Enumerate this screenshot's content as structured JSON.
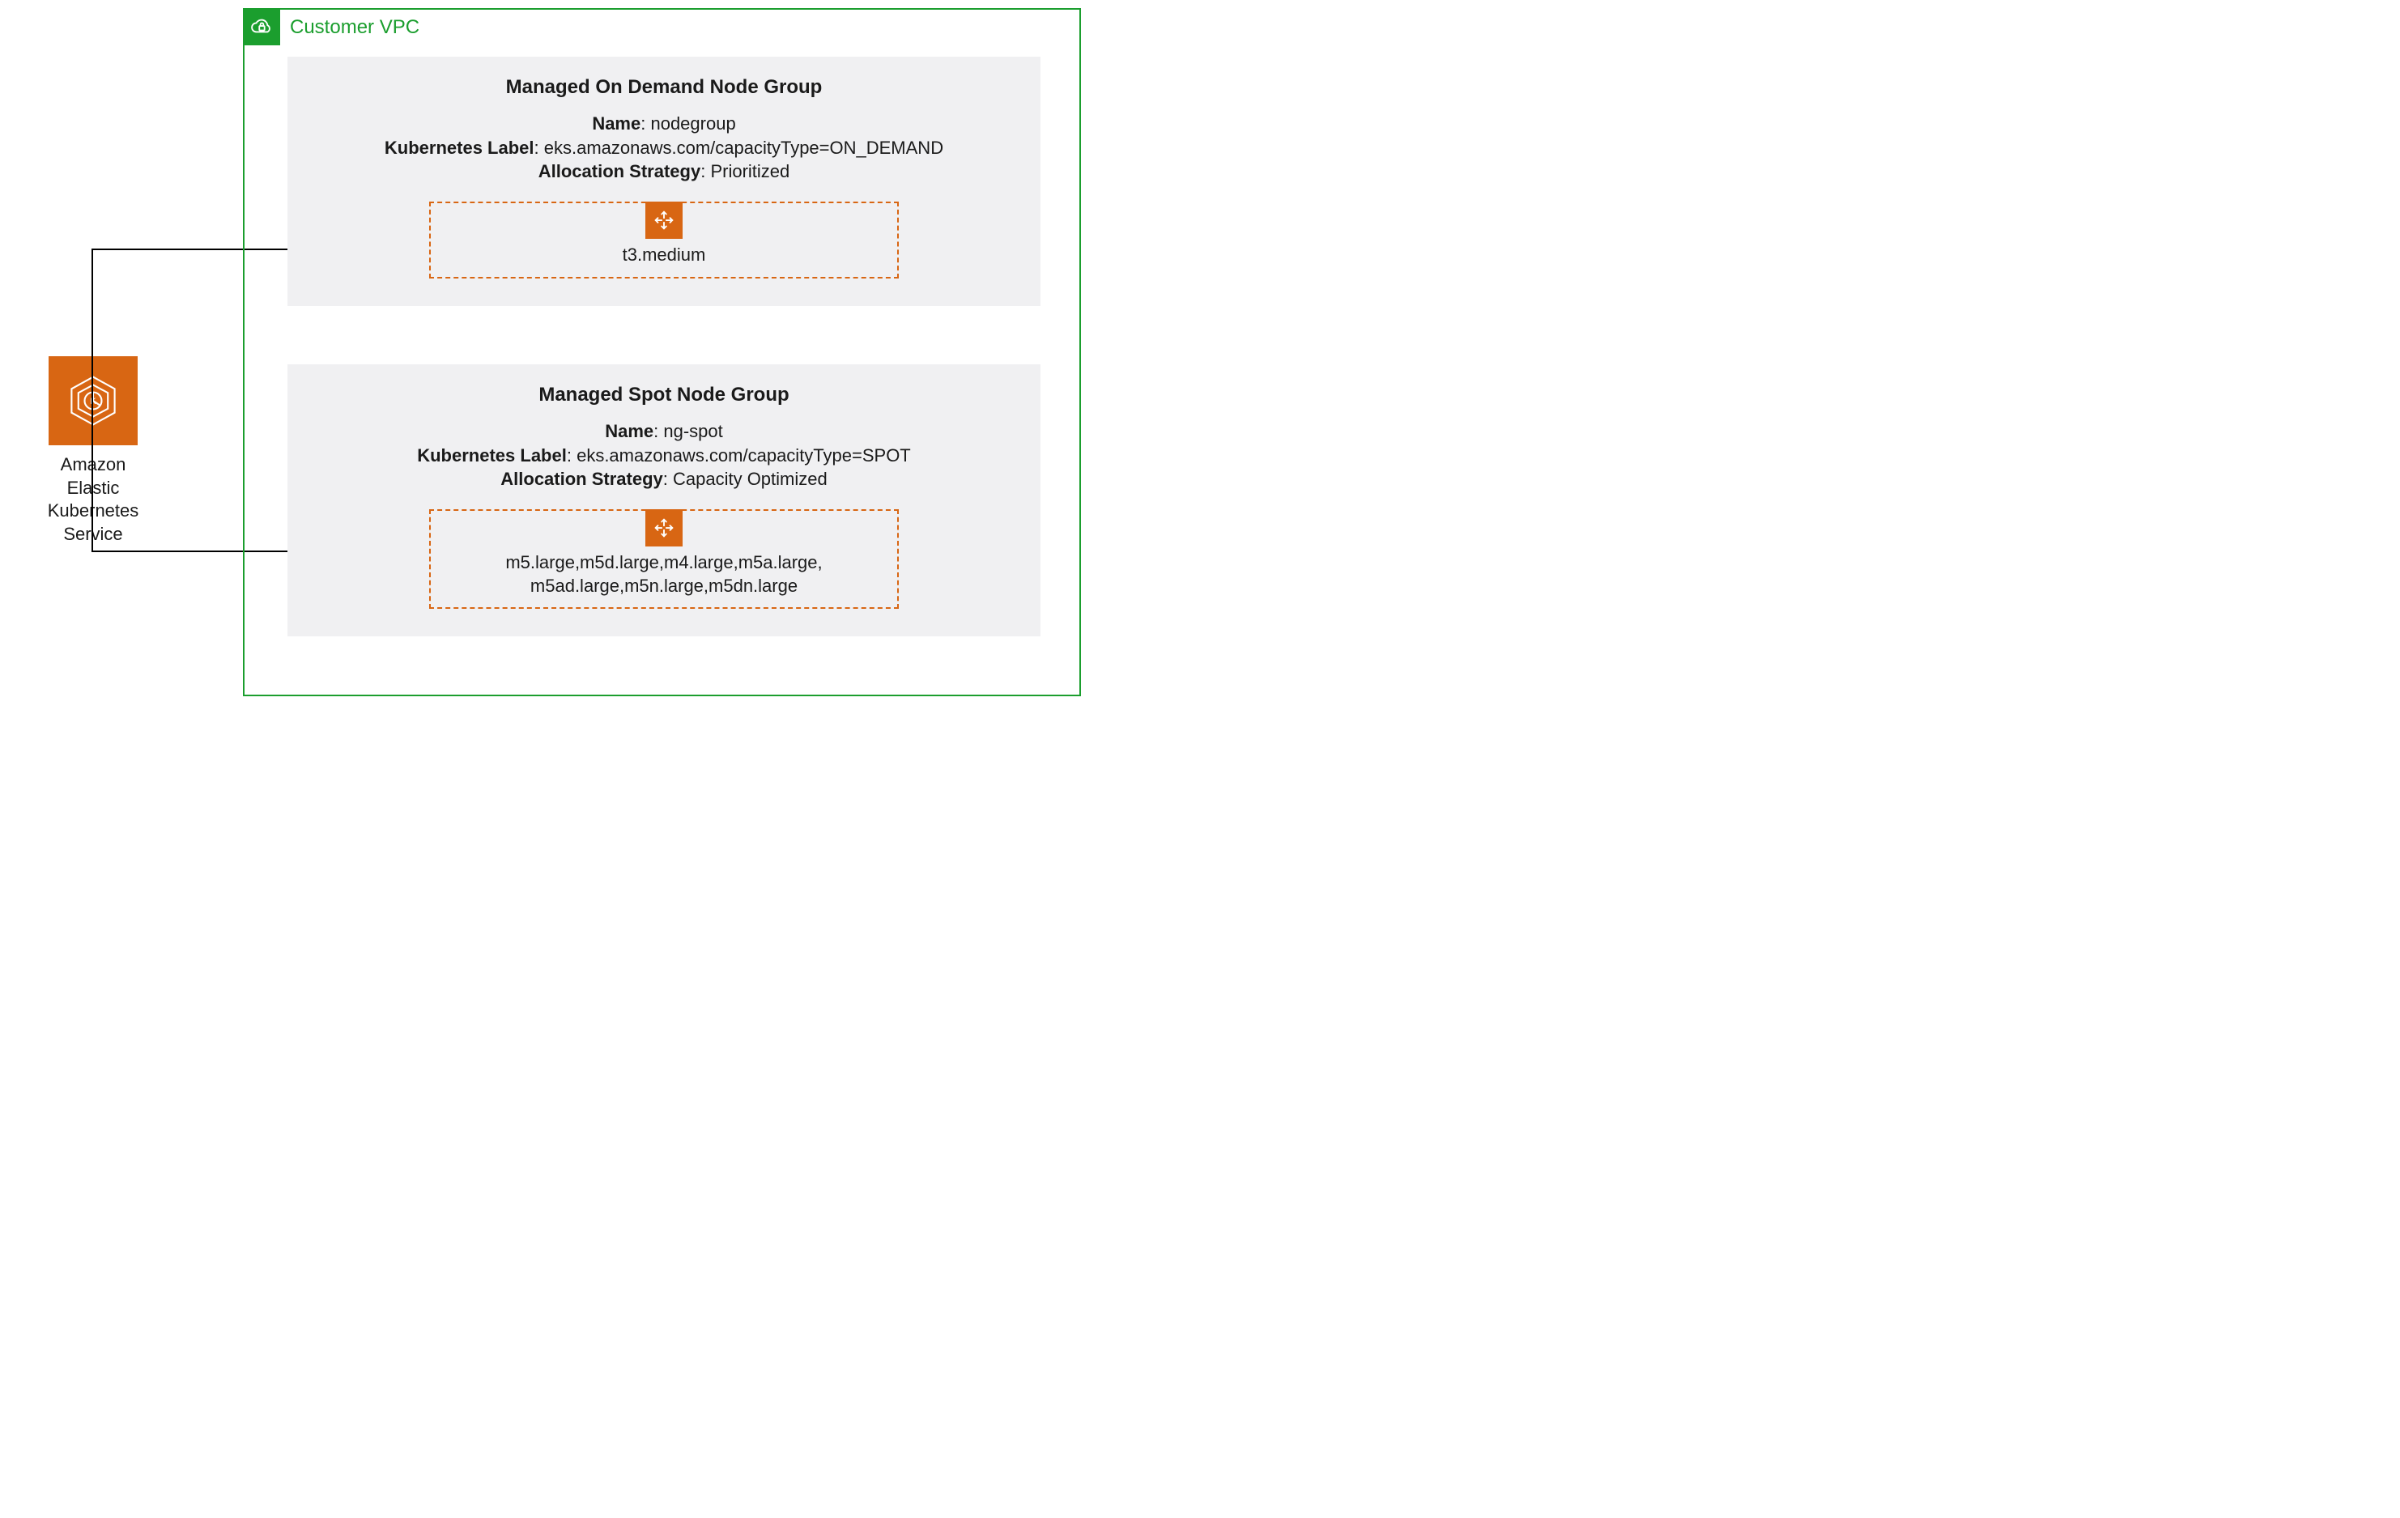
{
  "eks": {
    "label_l1": "Amazon",
    "label_l2": "Elastic",
    "label_l3": "Kubernetes",
    "label_l4": "Service"
  },
  "vpc": {
    "title": "Customer VPC"
  },
  "ng1": {
    "title": "Managed On Demand Node Group",
    "name_label": "Name",
    "name_value": "nodegroup",
    "klabel_label": "Kubernetes Label",
    "klabel_value": "eks.amazonaws.com/capacityType=ON_DEMAND",
    "alloc_label": "Allocation Strategy",
    "alloc_value": "Prioritized",
    "instances": "t3.medium"
  },
  "ng2": {
    "title": "Managed Spot Node Group",
    "name_label": "Name",
    "name_value": "ng-spot",
    "klabel_label": "Kubernetes Label",
    "klabel_value": "eks.amazonaws.com/capacityType=SPOT",
    "alloc_label": "Allocation Strategy",
    "alloc_value": "Capacity Optimized",
    "instances_l1": "m5.large,m5d.large,m4.large,m5a.large,",
    "instances_l2": "m5ad.large,m5n.large,m5dn.large"
  }
}
